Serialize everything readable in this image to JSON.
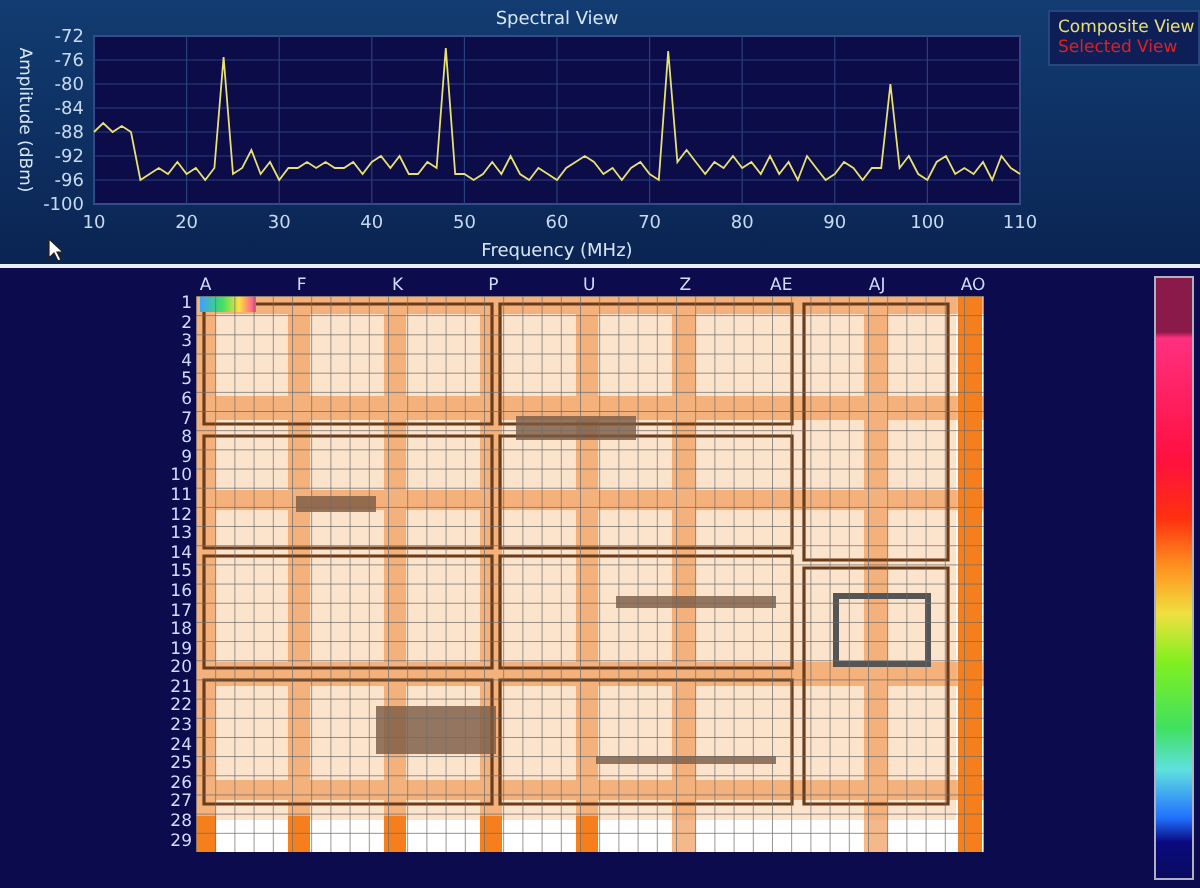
{
  "spectral_view": {
    "chart_data": {
      "type": "line",
      "title": "Spectral View",
      "xlabel": "Frequency (MHz)",
      "ylabel": "Amplitude (dBm)",
      "x": [
        10,
        11,
        12,
        13,
        14,
        15,
        16,
        17,
        18,
        19,
        20,
        21,
        22,
        23,
        24,
        25,
        26,
        27,
        28,
        29,
        30,
        31,
        32,
        33,
        34,
        35,
        36,
        37,
        38,
        39,
        40,
        41,
        42,
        43,
        44,
        45,
        46,
        47,
        48,
        49,
        50,
        51,
        52,
        53,
        54,
        55,
        56,
        57,
        58,
        59,
        60,
        61,
        62,
        63,
        64,
        65,
        66,
        67,
        68,
        69,
        70,
        71,
        72,
        73,
        74,
        75,
        76,
        77,
        78,
        79,
        80,
        81,
        82,
        83,
        84,
        85,
        86,
        87,
        88,
        89,
        90,
        91,
        92,
        93,
        94,
        95,
        96,
        97,
        98,
        99,
        100,
        101,
        102,
        103,
        104,
        105,
        106,
        107,
        108,
        109,
        110
      ],
      "series": [
        {
          "name": "Composite View",
          "color": "#e8e070",
          "values": [
            -88,
            -86.5,
            -88,
            -87,
            -88,
            -96,
            -95,
            -94,
            -95,
            -93,
            -95,
            -94,
            -96,
            -94,
            -75.5,
            -95,
            -94,
            -91,
            -95,
            -93,
            -96,
            -94,
            -94,
            -93,
            -94,
            -93,
            -94,
            -94,
            -93,
            -95,
            -93,
            -92,
            -94,
            -92,
            -95,
            -95,
            -93,
            -94,
            -74,
            -95,
            -95,
            -96,
            -95,
            -93,
            -95,
            -92,
            -95,
            -96,
            -94,
            -95,
            -96,
            -94,
            -93,
            -92,
            -93,
            -95,
            -94,
            -96,
            -94,
            -93,
            -95,
            -96,
            -74.5,
            -93,
            -91,
            -93,
            -95,
            -93,
            -94,
            -92,
            -94,
            -93,
            -95,
            -92,
            -95,
            -93,
            -96,
            -92,
            -94,
            -96,
            -95,
            -93,
            -94,
            -96,
            -94,
            -94,
            -80,
            -94,
            -92,
            -95,
            -96,
            -93,
            -92,
            -95,
            -94,
            -95,
            -93,
            -96,
            -92,
            -94,
            -95
          ]
        }
      ],
      "grid": true,
      "xlim": [
        10,
        110
      ],
      "ylim": [
        -100,
        -72
      ],
      "xticks": [
        10,
        20,
        30,
        40,
        50,
        60,
        70,
        80,
        90,
        100,
        110
      ],
      "yticks": [
        -72,
        -76,
        -80,
        -84,
        -88,
        -92,
        -96,
        -100
      ]
    }
  },
  "legend": [
    {
      "label": "Selected View",
      "color": "#e02020"
    }
  ],
  "board_map": {
    "columns": [
      "A",
      "F",
      "K",
      "P",
      "U",
      "Z",
      "AE",
      "AJ",
      "AO"
    ],
    "rows": [
      "1",
      "2",
      "3",
      "4",
      "5",
      "6",
      "7",
      "8",
      "9",
      "10",
      "11",
      "12",
      "13",
      "14",
      "15",
      "16",
      "17",
      "18",
      "19",
      "20",
      "21",
      "22",
      "23",
      "24",
      "25",
      "26",
      "27",
      "28",
      "29"
    ]
  }
}
